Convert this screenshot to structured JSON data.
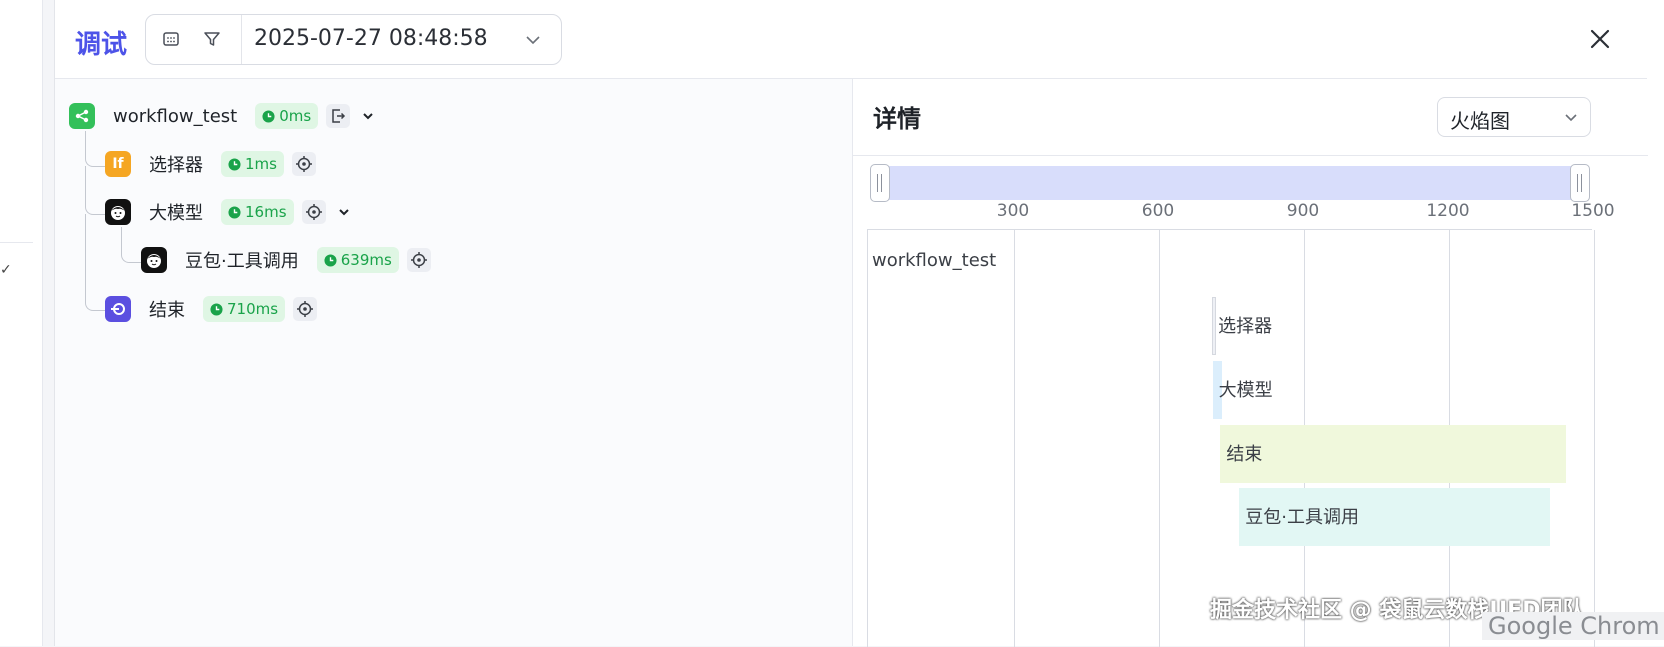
{
  "header": {
    "title": "调试",
    "datetime": "2025-07-27 08:48:58"
  },
  "tree": {
    "root": {
      "label": "workflow_test",
      "duration": "0ms"
    },
    "nodes": [
      {
        "label": "选择器",
        "duration": "1ms",
        "icon_text": "If"
      },
      {
        "label": "大模型",
        "duration": "16ms"
      },
      {
        "label": "豆包·工具调用",
        "duration": "639ms"
      },
      {
        "label": "结束",
        "duration": "710ms"
      }
    ]
  },
  "detail": {
    "title": "详情",
    "view_select": "火焰图"
  },
  "chart_data": {
    "type": "flame",
    "x_ticks": [
      "300",
      "600",
      "900",
      "1200",
      "1500"
    ],
    "bars": [
      {
        "label": "workflow_test",
        "start": 0,
        "duration": 0,
        "color": "#ffffff"
      },
      {
        "label": "选择器",
        "start": 710,
        "duration": 1,
        "color": "#eef0f5"
      },
      {
        "label": "大模型",
        "start": 711,
        "duration": 16,
        "color": "#dbeefc"
      },
      {
        "label": "结束",
        "start": 727,
        "duration": 710,
        "color": "#f0f8dc"
      },
      {
        "label": "豆包·工具调用",
        "start": 766,
        "duration": 639,
        "color": "#e2f7f4"
      }
    ]
  },
  "footer": {
    "watermark": "掘金技术社区 @ 袋鼠云数栈UED团队",
    "browser": "Google Chrom"
  }
}
